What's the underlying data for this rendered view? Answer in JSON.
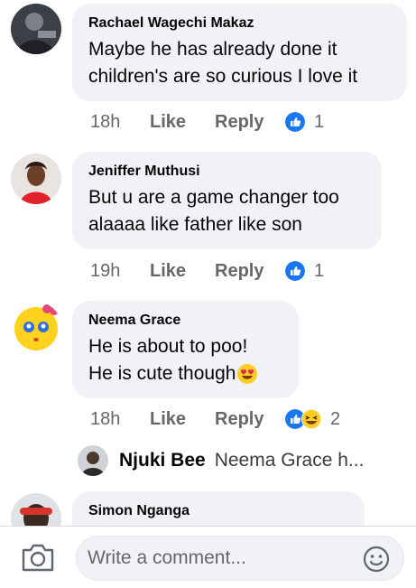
{
  "comments": [
    {
      "author": "Rachael Wagechi Makaz",
      "body_lines": [
        "Maybe he has already done it",
        "children's are so curious I love it"
      ],
      "time": "18h",
      "like_label": "Like",
      "reply_label": "Reply",
      "reaction_count": "1",
      "reactions": [
        "like"
      ]
    },
    {
      "author": "Jeniffer Muthusi",
      "body_lines": [
        "But u are a game changer too",
        "alaaaa like father like son"
      ],
      "time": "19h",
      "like_label": "Like",
      "reply_label": "Reply",
      "reaction_count": "1",
      "reactions": [
        "like"
      ]
    },
    {
      "author": "Neema Grace",
      "body_lines": [
        "He is about to poo!",
        "He is cute though"
      ],
      "time": "18h",
      "like_label": "Like",
      "reply_label": "Reply",
      "reaction_count": "2",
      "reactions": [
        "like",
        "haha"
      ]
    },
    {
      "author": "Simon Nganga"
    }
  ],
  "reply_preview": {
    "author": "Njuki Bee",
    "text": "Neema Grace h..."
  },
  "composer": {
    "placeholder": "Write a comment..."
  },
  "colors": {
    "bubble": "#f0f2f5",
    "like_blue": "#1877f2",
    "meta_gray": "#65676b"
  },
  "icons": [
    "camera-icon",
    "smiley-icon",
    "like-reaction-icon",
    "haha-reaction-icon",
    "heart-eyes-emoji"
  ]
}
